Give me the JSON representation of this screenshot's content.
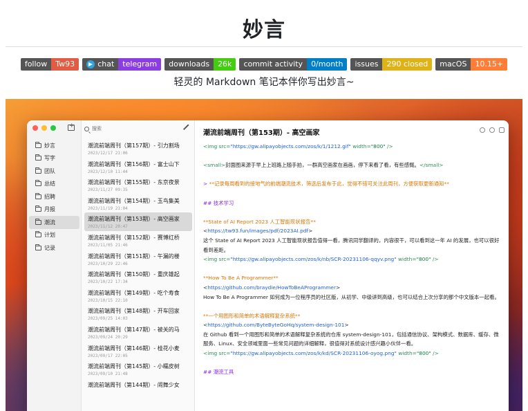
{
  "header": {
    "title": "妙言",
    "tagline": "轻灵的 Markdown 笔记本伴你写出妙言~"
  },
  "badges": [
    {
      "label": "follow",
      "value": "Tw93",
      "color": "#e05d44"
    },
    {
      "label": "chat",
      "value": "telegram",
      "color": "#8b3ee0",
      "icon": "telegram-icon"
    },
    {
      "label": "downloads",
      "value": "26k",
      "color": "#4c1"
    },
    {
      "label": "commit activity",
      "value": "0/month",
      "color": "#007ec6"
    },
    {
      "label": "issues",
      "value": "290 closed",
      "color": "#dfb317"
    },
    {
      "label": "macOS",
      "value": "10.15+",
      "color": "#fe7d37"
    }
  ],
  "app": {
    "sidebar": {
      "items": [
        {
          "label": "妙言",
          "active": false
        },
        {
          "label": "写字",
          "active": false
        },
        {
          "label": "团队",
          "active": false
        },
        {
          "label": "总结",
          "active": false
        },
        {
          "label": "招聘",
          "active": false
        },
        {
          "label": "月报",
          "active": false
        },
        {
          "label": "潮流",
          "active": true
        },
        {
          "label": "计划",
          "active": false
        },
        {
          "label": "记录",
          "active": false
        }
      ]
    },
    "search": {
      "placeholder": "搜索"
    },
    "notes": [
      {
        "title": "潮流前端周刊（第157期）- 引力割场",
        "date": "2023/12/17 21:06",
        "active": false
      },
      {
        "title": "潮流前端周刊（第156期）- 富士山下",
        "date": "2023/12/10 11:44",
        "active": false
      },
      {
        "title": "潮流前端周刊（第155期）- 东京夜景",
        "date": "2023/11/27 09:35",
        "active": false
      },
      {
        "title": "潮流前端周刊（第154期）- 玉鸟集美",
        "date": "2023/11/19 21:04",
        "active": false
      },
      {
        "title": "潮流前端周刊（第153期）- 高空画家",
        "date": "2023/11/12 20:47",
        "active": true
      },
      {
        "title": "潮流前端周刊（第152期）- 赛博红桥",
        "date": "2023/11/05 21:46",
        "active": false
      },
      {
        "title": "潮流前端周刊（第151期）- 午漏的楼",
        "date": "2023/10/29 22:46",
        "active": false
      },
      {
        "title": "潮流前端周刊（第150期）- 重庆雄起",
        "date": "2023/10/22 17:34",
        "active": false
      },
      {
        "title": "潮流前端周刊（第149期）- 吃个寿食",
        "date": "2023/10/15 22:10",
        "active": false
      },
      {
        "title": "潮流前端周刊（第148期）- 开车回家",
        "date": "2023/09/25 14:03",
        "active": false
      },
      {
        "title": "潮流前端周刊（第147期）- 被关的马",
        "date": "2023/09/24 20:29",
        "active": false
      },
      {
        "title": "潮流前端周刊（第146期）- 桂花小麦",
        "date": "2023/09/17 22:05",
        "active": false
      },
      {
        "title": "潮流前端周刊（第145期）- 小糯皮树",
        "date": "2023/09/10 21:48",
        "active": false
      },
      {
        "title": "潮流前端周刊（第144期）- 闹舞少女",
        "date": "",
        "active": false
      }
    ],
    "editor": {
      "title": "潮流前端周刊（第153期）- 高空画家",
      "lines": [
        [
          {
            "t": "<img src=",
            "c": "c-tag"
          },
          {
            "t": "\"https://gw.alipayobjects.com/zos/k/1/1212.gif\"",
            "c": "c-blue"
          },
          {
            "t": " width=",
            "c": "c-tag"
          },
          {
            "t": "\"800\"",
            "c": "c-str"
          },
          {
            "t": " />",
            "c": "c-tag"
          }
        ],
        [],
        [
          {
            "t": "<small>",
            "c": "c-tag"
          },
          {
            "t": "封面图来源于早上上班路上随手拍，一群高空画家在画画，停下来看了看，有些感慨。",
            "c": ""
          },
          {
            "t": "</small>",
            "c": "c-tag"
          }
        ],
        [],
        [
          {
            "t": "> ",
            "c": "c-purple"
          },
          {
            "t": "**记录每周看到的接地气的前端潮流技术，筛选后发布于此，觉得不错可关注此周刊，方便获取更新通知**",
            "c": "c-orange"
          }
        ],
        [],
        [
          {
            "t": "## 技术学习",
            "c": "c-purple"
          }
        ],
        [],
        [
          {
            "t": "**State of AI Report 2023 人工智能现状报告**",
            "c": "c-orange"
          }
        ],
        [
          {
            "t": "<",
            "c": ""
          },
          {
            "t": "https://tw93.fun/images/pdf/2023AI.pdf",
            "c": "c-blue"
          },
          {
            "t": ">",
            "c": ""
          }
        ],
        [
          {
            "t": "这个 State of AI Report 2023 人工智能现状报告值得一看，腾讯同学翻译的，内容很干，可以看到这一年 AI 的发展，也可以很好看到差距。",
            "c": ""
          }
        ],
        [
          {
            "t": "<img src=",
            "c": "c-tag"
          },
          {
            "t": "\"https://gw.alipayobjects.com/zos/k/nb/SCR-20231106-qqyv.png\"",
            "c": "c-blue"
          },
          {
            "t": " width=",
            "c": "c-tag"
          },
          {
            "t": "\"800\"",
            "c": "c-str"
          },
          {
            "t": " />",
            "c": "c-tag"
          }
        ],
        [],
        [
          {
            "t": "**How To Be A Programmer**",
            "c": "c-orange"
          }
        ],
        [
          {
            "t": "<",
            "c": ""
          },
          {
            "t": "https://github.com/braydie/HowToBeAProgrammer",
            "c": "c-blue"
          },
          {
            "t": ">",
            "c": ""
          }
        ],
        [
          {
            "t": "How To Be A Programmer 如何成为一位程序员的社区版，从初学、中级讲到高级，也可以结合上次分享的那个中文版本一起看。",
            "c": ""
          }
        ],
        [],
        [
          {
            "t": "**一个用图形和简单的术语解释复杂系统**",
            "c": "c-orange"
          }
        ],
        [
          {
            "t": "<",
            "c": ""
          },
          {
            "t": "https://github.com/ByteByteGoHq/system-design-101",
            "c": "c-blue"
          },
          {
            "t": ">",
            "c": ""
          }
        ],
        [
          {
            "t": "在 Github 看到一个用图形和简单的术语解释复杂系统的仓库 system-design-101，包括通信协议、架构模式、数据库、缓存、微服务、Linux、安全领域里面一些常见问题的详细解释，很值得对系统设计感兴趣小伙伴一看。",
            "c": ""
          }
        ],
        [
          {
            "t": "<img src=",
            "c": "c-tag"
          },
          {
            "t": "\"https://gw.alipayobjects.com/zos/k/kd/SCR-20231106-oyog.png\"",
            "c": "c-blue"
          },
          {
            "t": " width=",
            "c": "c-tag"
          },
          {
            "t": "\"800\"",
            "c": "c-str"
          },
          {
            "t": " />",
            "c": "c-tag"
          }
        ],
        [],
        [
          {
            "t": "## 潮流工具",
            "c": "c-purple"
          }
        ]
      ]
    }
  }
}
